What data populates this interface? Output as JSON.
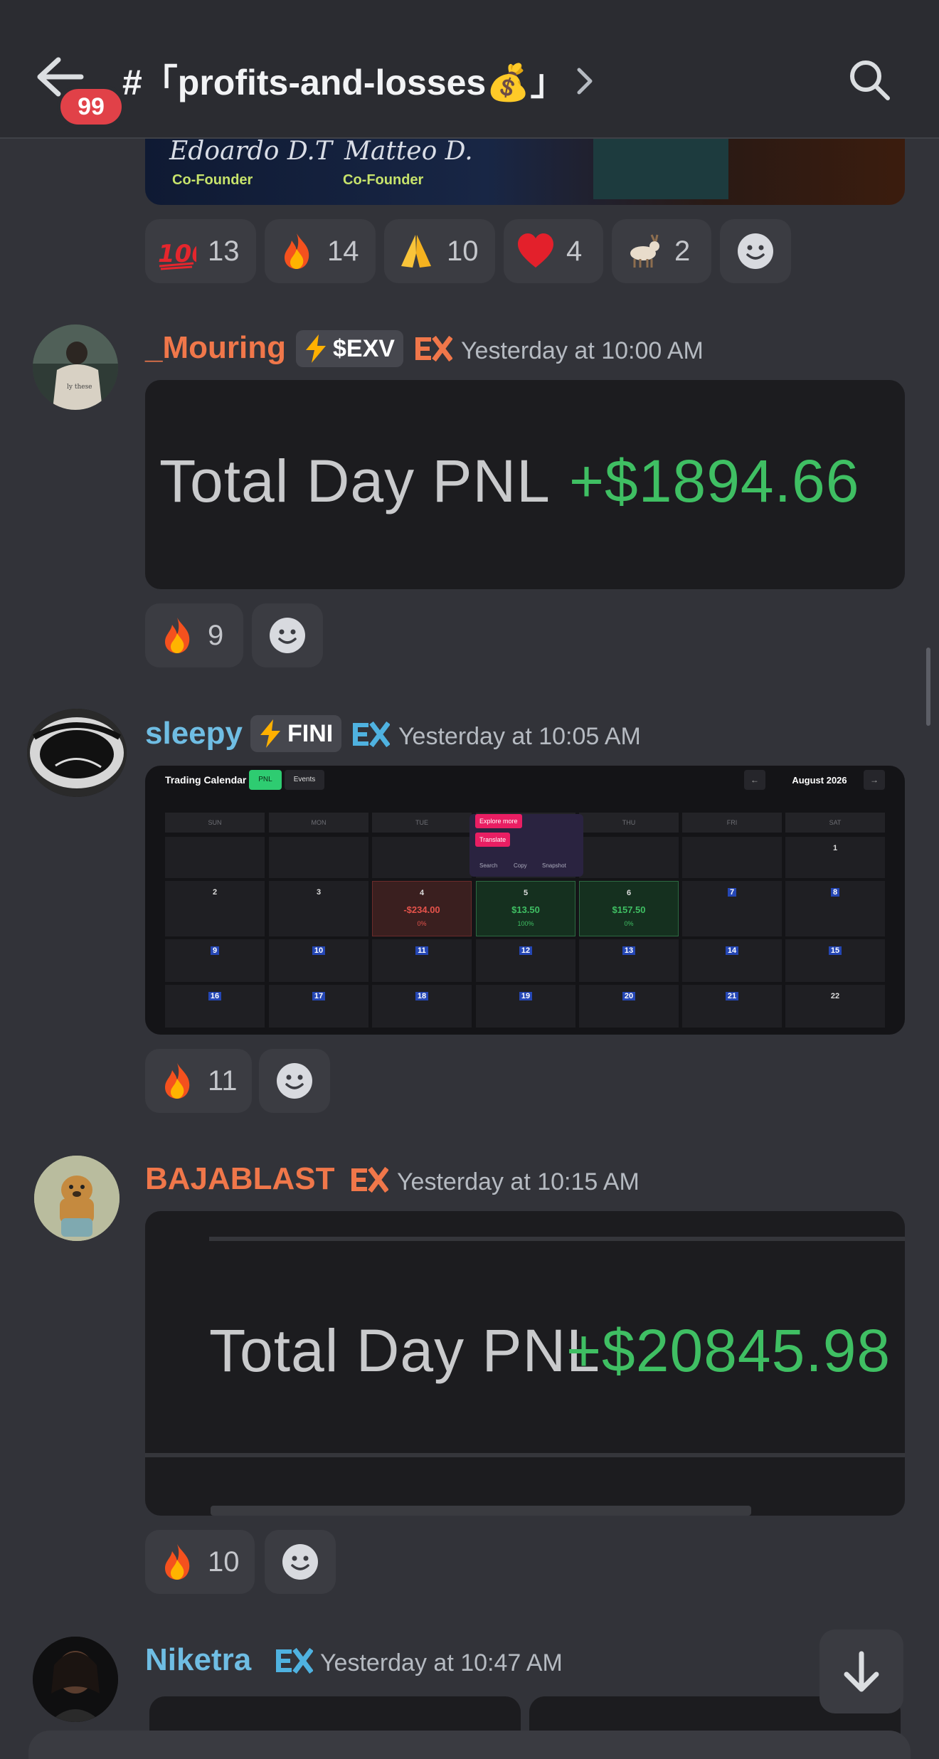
{
  "header": {
    "channel_name": "#「profits-and-losses💰」",
    "unread_count": "99"
  },
  "top_embed": {
    "founder_1_name": "Edoardo D.T",
    "founder_1_role": "Co-Founder",
    "founder_2_name": "Matteo D.",
    "founder_2_role": "Co-Founder"
  },
  "top_reactions": [
    {
      "emoji": "hundred-points",
      "count": "13"
    },
    {
      "emoji": "fire",
      "count": "14"
    },
    {
      "emoji": "folded-hands",
      "count": "10"
    },
    {
      "emoji": "red-heart",
      "count": "4"
    },
    {
      "emoji": "goat",
      "count": "2"
    }
  ],
  "messages": [
    {
      "username": "_Mouring",
      "username_color": "#f0774a",
      "tag": "$EXV",
      "timestamp": "Yesterday at 10:00 AM",
      "pnl_label": "Total Day PNL",
      "pnl_value": "+$1894.66",
      "reactions": [
        {
          "emoji": "fire",
          "count": "9"
        }
      ]
    },
    {
      "username": "sleepy",
      "username_color": "#6fbde3",
      "tag": "FINI",
      "timestamp": "Yesterday at 10:05 AM",
      "reactions": [
        {
          "emoji": "fire",
          "count": "11"
        }
      ]
    },
    {
      "username": "BAJABLAST",
      "username_color": "#f0774a",
      "timestamp": "Yesterday at 10:15 AM",
      "pnl_label": "Total Day PNL",
      "pnl_value": "+$20845.98",
      "reactions": [
        {
          "emoji": "fire",
          "count": "10"
        }
      ]
    },
    {
      "username": "Niketra",
      "username_color": "#6fbde3",
      "timestamp": "Yesterday at 10:47 AM"
    }
  ],
  "calendar": {
    "title": "Trading Calendar",
    "tab_pnl": "PNL",
    "tab_events": "Events",
    "prev": "←",
    "next": "→",
    "month": "August 2026",
    "weekdays": [
      "SUN",
      "MON",
      "TUE",
      "WED",
      "THU",
      "FRI",
      "SAT"
    ],
    "days": [
      "1",
      "2",
      "3",
      "4",
      "5",
      "6",
      "7",
      "8",
      "9",
      "10",
      "11",
      "12",
      "13",
      "14",
      "15",
      "16",
      "17",
      "18",
      "19",
      "20",
      "21",
      "22"
    ],
    "day4_amount": "-$234.00",
    "day4_pct": "0%",
    "day5_amount": "$13.50",
    "day5_pct": "100%",
    "day6_amount": "$157.50",
    "day6_pct": "0%",
    "menu_explore": "Explore more",
    "menu_translate": "Translate",
    "menu_search": "Search",
    "menu_copy": "Copy",
    "menu_snapshot": "Snapshot"
  },
  "colors": {
    "background": "#323339",
    "header": "#2b2c31",
    "pnl_green": "#3fbf63",
    "loss_red": "#e5534b",
    "badge_red": "#e14148"
  }
}
